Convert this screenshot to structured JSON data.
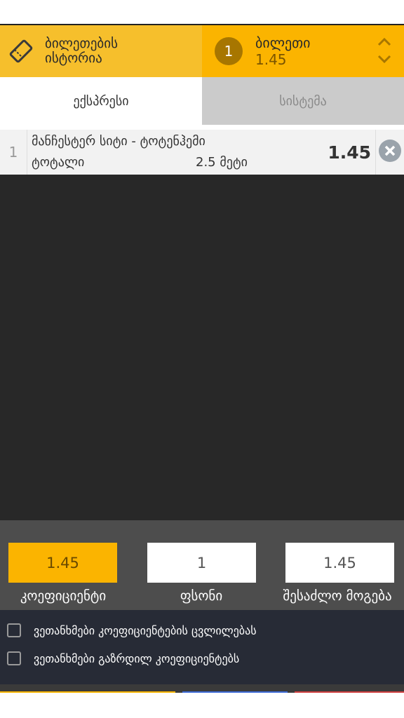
{
  "header": {
    "history_label": "ბილეთების\nისტორია",
    "ticket_count": "1",
    "ticket_label": "ბილეთი",
    "ticket_total_odds": "1.45"
  },
  "tabs": [
    {
      "label": "ექსპრესი",
      "active": true
    },
    {
      "label": "სისტემა",
      "active": false
    }
  ],
  "bet": {
    "index": "1",
    "match": "მანჩესტერ სიტი - ტოტენჰემი",
    "market": "ტოტალი",
    "selection": "2.5 მეტი",
    "odds": "1.45"
  },
  "calc": {
    "odds_value": "1.45",
    "odds_label": "კოეფიციენტი",
    "stake_value": "1",
    "stake_label": "ფსონი",
    "win_value": "1.45",
    "win_label": "შესაძლო მოგება"
  },
  "agreements": [
    {
      "label": "ვეთანხმები კოეფიციენტების ცვლილებას",
      "checked": false
    },
    {
      "label": "ვეთანხმები გაზრდილ კოეფიციენტებს",
      "checked": false
    }
  ],
  "colors": {
    "accent": "#fbb400",
    "history_bg": "#f6bf2c",
    "dark_area": "#282828",
    "calc_bg": "#4d4d4d",
    "agree_bg": "#272b36"
  }
}
